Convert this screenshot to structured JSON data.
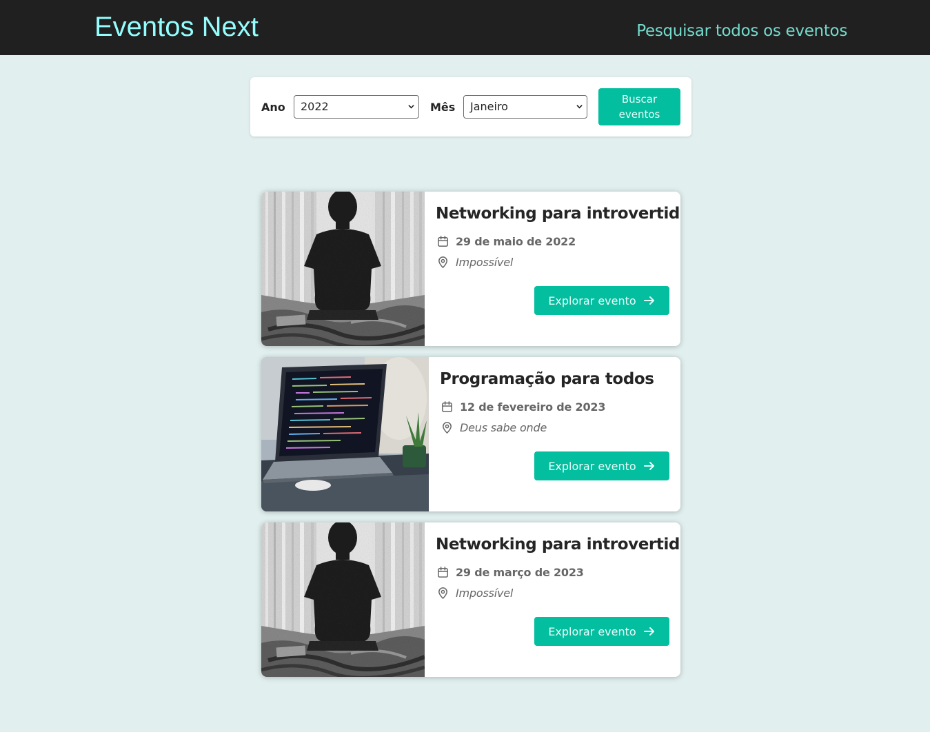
{
  "header": {
    "logo": "Eventos Next",
    "nav_link": "Pesquisar todos os eventos"
  },
  "search": {
    "year_label": "Ano",
    "year_value": "2022",
    "month_label": "Mês",
    "month_value": "Janeiro",
    "submit_label": "Buscar eventos"
  },
  "events": [
    {
      "title": "Networking para introvertidos",
      "date": "29 de maio de 2022",
      "address": "Impossível",
      "button": "Explorar evento",
      "image": "person-silhouette-photo"
    },
    {
      "title": "Programação para todos",
      "date": "12 de fevereiro de 2023",
      "address": "Deus sabe onde",
      "button": "Explorar evento",
      "image": "laptop-code-photo"
    },
    {
      "title": "Networking para introvertidos",
      "date": "29 de março de 2023",
      "address": "Impossível",
      "button": "Explorar evento",
      "image": "person-silhouette-photo"
    }
  ],
  "colors": {
    "header_bg": "#202020",
    "logo": "#94fdfd",
    "nav_link": "#74dacc",
    "page_bg": "#e1efef",
    "accent": "#03be9f"
  }
}
